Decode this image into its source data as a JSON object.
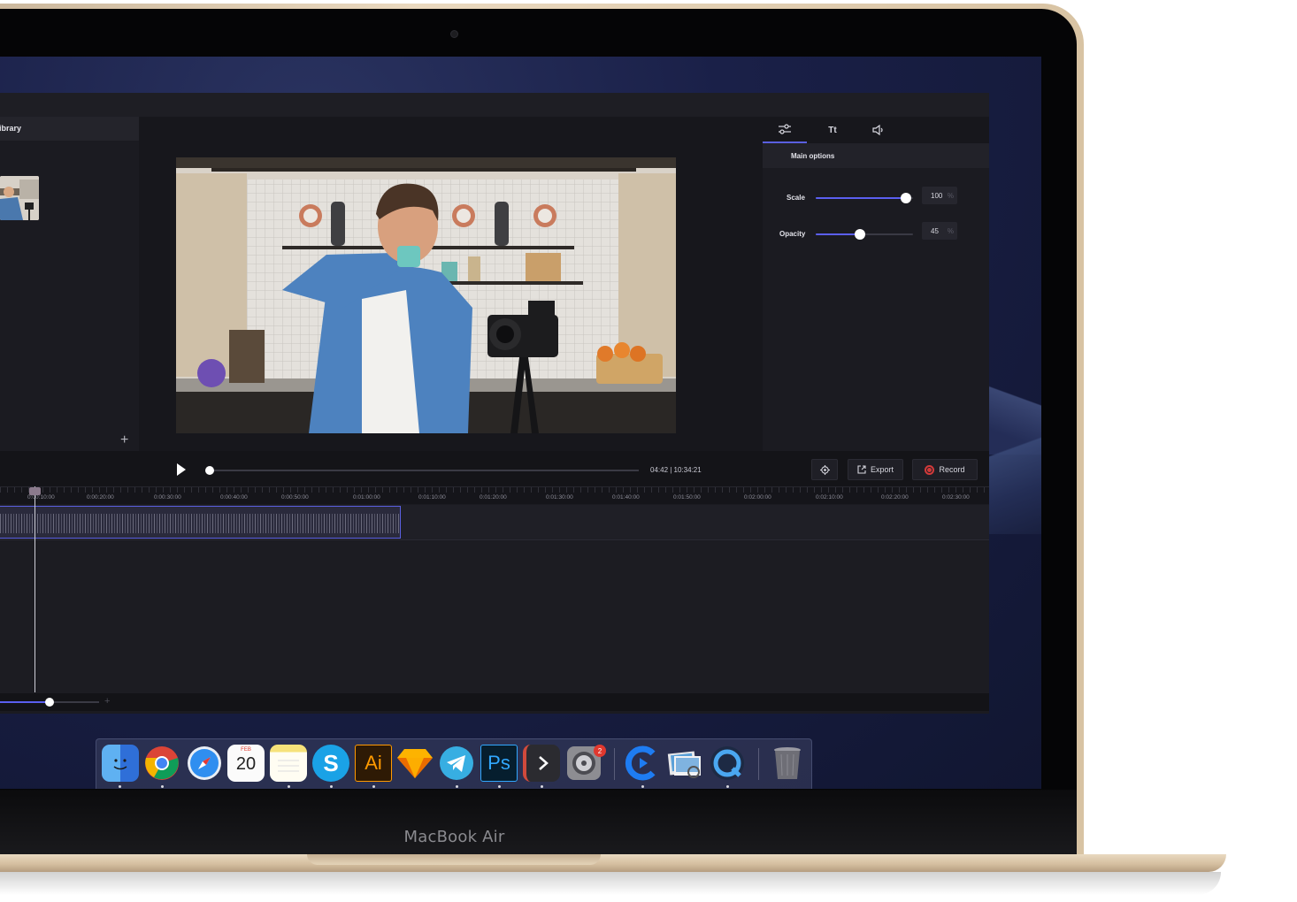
{
  "device": {
    "brand_label": "MacBook Air"
  },
  "library": {
    "title": "ibrary",
    "add_icon": "plus-icon"
  },
  "options": {
    "tabs": [
      {
        "name": "adjust",
        "icon": "sliders-icon",
        "label": ""
      },
      {
        "name": "text",
        "icon": "text-icon",
        "label": "Tt"
      },
      {
        "name": "audio",
        "icon": "speaker-icon",
        "label": ""
      }
    ],
    "section_title": "Main options",
    "scale": {
      "label": "Scale",
      "value": "100",
      "unit": "%",
      "level": 0.93
    },
    "opacity": {
      "label": "Opacity",
      "value": "45",
      "unit": "%",
      "level": 0.45
    }
  },
  "playback": {
    "timecode": "04:42 | 10:34:21",
    "progress": 0.0,
    "export_label": "Export",
    "record_label": "Record"
  },
  "timeline": {
    "ruler_labels": [
      "0:00:10:00",
      "0:00:20:00",
      "0:00:30:00",
      "0:00:40:00",
      "0:00:50:00",
      "0:01:00:00",
      "0:01:10:00",
      "0:01:20:00",
      "0:01:30:00",
      "0:01:40:00",
      "0:01:50:00",
      "0:02:00:00",
      "0:02:10:00",
      "0:02:20:00",
      "0:02:30:00"
    ],
    "zoom_level": 0.5
  },
  "dock": {
    "items": [
      "finder-icon",
      "chrome-icon",
      "safari-icon",
      "calendar-icon",
      "notes-icon",
      "skype-icon",
      "illustrator-icon",
      "sketch-icon",
      "telegram-icon",
      "photoshop-icon",
      "terminal-icon",
      "system-preferences-icon",
      "app-c-icon",
      "preview-icon",
      "quicktime-icon",
      "trash-icon"
    ],
    "calendar_month": "FEB",
    "calendar_day": "20",
    "illustrator_text": "Ai",
    "photoshop_text": "Ps",
    "skype_text": "S",
    "badge_count": "2"
  },
  "colors": {
    "accent": "#5b5ff0",
    "record": "#d23a3a"
  }
}
